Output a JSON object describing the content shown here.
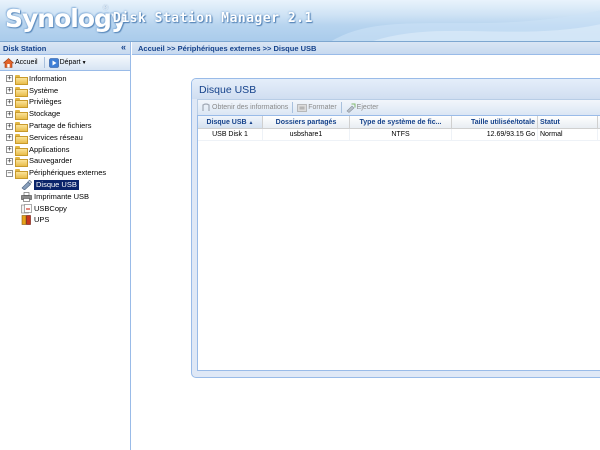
{
  "header": {
    "logo": "Synology",
    "logo_mark": "®",
    "title": "Disk Station Manager 2.1"
  },
  "sidebar": {
    "title": "Disk Station",
    "collapse_glyph": "«",
    "toolbar": {
      "home_label": "Accueil",
      "start_label": "Départ"
    },
    "items": [
      {
        "label": "Information"
      },
      {
        "label": "Système"
      },
      {
        "label": "Privilèges"
      },
      {
        "label": "Stockage"
      },
      {
        "label": "Partage de fichiers"
      },
      {
        "label": "Services réseau"
      },
      {
        "label": "Applications"
      },
      {
        "label": "Sauvegarder"
      },
      {
        "label": "Périphériques externes"
      }
    ],
    "children": [
      {
        "label": "Disque USB",
        "selected": true
      },
      {
        "label": "Imprimante USB"
      },
      {
        "label": "USBCopy"
      },
      {
        "label": "UPS"
      }
    ]
  },
  "breadcrumb": "Accueil >> Périphériques externes >> Disque USB",
  "panel": {
    "title": "Disque USB",
    "toolbar": {
      "info_label": "Obtenir des informations",
      "format_label": "Formater",
      "eject_label": "Ejecter"
    },
    "columns": [
      "Disque USB",
      "Dossiers partagés",
      "Type de système de fic...",
      "Taille utilisée/totale",
      "Statut"
    ],
    "rows": [
      [
        "USB Disk 1",
        "usbshare1",
        "NTFS",
        "12.69/93.15 Go",
        "Normal"
      ]
    ]
  },
  "colors": {
    "accent": "#15428b",
    "selection": "#0a246a",
    "border": "#99bbe8"
  }
}
